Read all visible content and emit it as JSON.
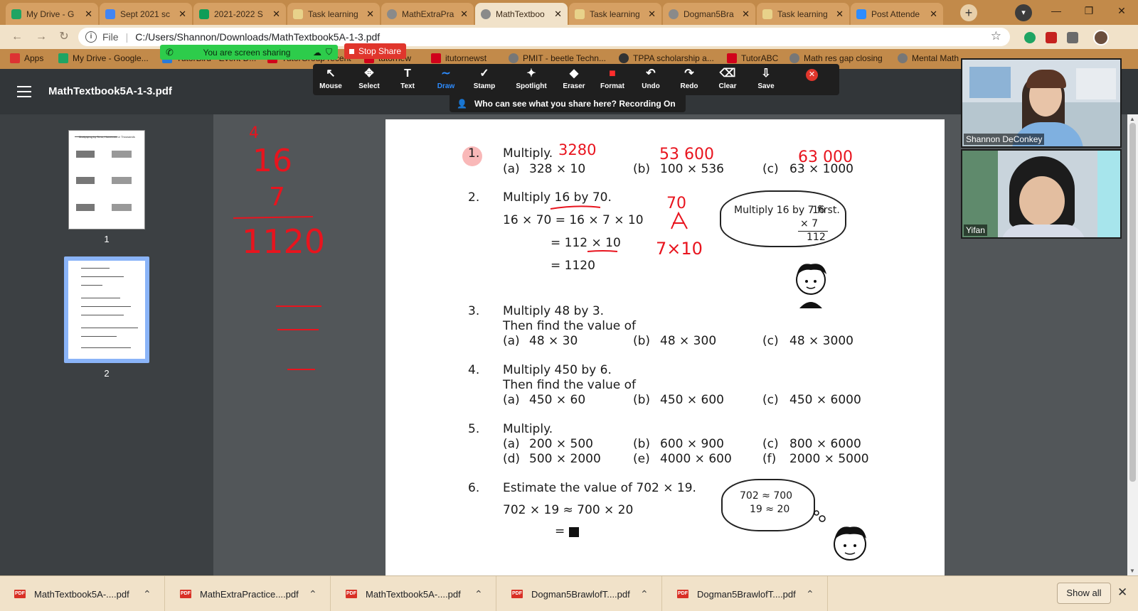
{
  "browser": {
    "tabs": [
      {
        "title": "My Drive - G",
        "favicon": "google-drive-icon",
        "color": "#1fa463"
      },
      {
        "title": "Sept 2021 sc",
        "favicon": "google-docs-icon",
        "color": "#4285f4"
      },
      {
        "title": "2021-2022 S",
        "favicon": "google-sheets-icon",
        "color": "#0f9d58"
      },
      {
        "title": "Task learning",
        "favicon": "task-icon",
        "color": "#e8d28a"
      },
      {
        "title": "MathExtraPra",
        "favicon": "globe-icon",
        "color": "#8a8a8a"
      },
      {
        "title": "MathTextboo",
        "favicon": "globe-icon",
        "color": "#8a8a8a"
      },
      {
        "title": "Task learning",
        "favicon": "task-icon",
        "color": "#e8d28a"
      },
      {
        "title": "Dogman5Bra",
        "favicon": "globe-icon",
        "color": "#8a8a8a"
      },
      {
        "title": "Task learning",
        "favicon": "task-icon",
        "color": "#e8d28a"
      },
      {
        "title": "Post Attende",
        "favicon": "zoom-icon",
        "color": "#2d8cff"
      }
    ],
    "active_tab": 5,
    "address": {
      "scheme": "File",
      "url": "C:/Users/Shannon/Downloads/MathTextbook5A-1-3.pdf"
    },
    "bookmarks": [
      {
        "label": "Apps",
        "icon": "apps-grid-icon",
        "color": "#d33"
      },
      {
        "label": "My Drive - Google...",
        "icon": "google-drive-icon",
        "color": "#1fa463"
      },
      {
        "label": "TutorBird - Event D...",
        "icon": "tutorbird-icon",
        "color": "#2a7bd8"
      },
      {
        "label": "TutorGroup recent",
        "icon": "info-icon",
        "color": "#d0021b"
      },
      {
        "label": "tutornew",
        "icon": "info-icon",
        "color": "#d0021b"
      },
      {
        "label": "itutornewst",
        "icon": "info-icon",
        "color": "#d0021b"
      },
      {
        "label": "PMIT - beetle Techn...",
        "icon": "globe-icon",
        "color": "#777"
      },
      {
        "label": "TPPA scholarship a...",
        "icon": "paw-icon",
        "color": "#333"
      },
      {
        "label": "TutorABC",
        "icon": "info-icon",
        "color": "#d0021b"
      },
      {
        "label": "Math res gap closing",
        "icon": "globe-icon",
        "color": "#777"
      },
      {
        "label": "Mental Math",
        "icon": "globe-icon",
        "color": "#777"
      }
    ]
  },
  "zoom": {
    "sharing_status": "You are screen sharing",
    "stop_share": "Stop Share",
    "tools": [
      {
        "label": "Mouse",
        "icon": "cursor-icon",
        "glyph": "↖"
      },
      {
        "label": "Select",
        "icon": "move-icon",
        "glyph": "✥"
      },
      {
        "label": "Text",
        "icon": "text-icon",
        "glyph": "T"
      },
      {
        "label": "Draw",
        "icon": "draw-icon",
        "glyph": "∼"
      },
      {
        "label": "Stamp",
        "icon": "stamp-icon",
        "glyph": "✓"
      },
      {
        "label": "Spotlight",
        "icon": "spotlight-icon",
        "glyph": "✦"
      },
      {
        "label": "Eraser",
        "icon": "eraser-icon",
        "glyph": "◆"
      },
      {
        "label": "Format",
        "icon": "format-icon",
        "glyph": "■"
      },
      {
        "label": "Undo",
        "icon": "undo-icon",
        "glyph": "↶"
      },
      {
        "label": "Redo",
        "icon": "redo-icon",
        "glyph": "↷"
      },
      {
        "label": "Clear",
        "icon": "trash-icon",
        "glyph": "🗑"
      },
      {
        "label": "Save",
        "icon": "save-icon",
        "glyph": "⇩"
      }
    ],
    "active_tool": "Draw",
    "recording_notice": "Who can see what you share here? Recording On",
    "participants": [
      {
        "name": "Shannon DeConkey"
      },
      {
        "name": "Yifan"
      }
    ]
  },
  "pdf": {
    "title": "MathTextbook5A-1-3.pdf",
    "pages": [
      "1",
      "2"
    ],
    "thumb1_heading": "Multiplying by Tens, Hundreds or Thousands",
    "content": {
      "q1": {
        "num": "1.",
        "prompt": "Multiply.",
        "a": "(a)",
        "a_expr": "328 × 10",
        "b": "(b)",
        "b_expr": "100 × 536",
        "c": "(c)",
        "c_expr": "63 × 1000"
      },
      "q2": {
        "num": "2.",
        "prompt": "Multiply 16 by 70.",
        "l1": "16 × 70  =  16 × 7 × 10",
        "l2": "=  112 × 10",
        "l3": "=  1120",
        "bubble_text": "Multiply 16 by 7 first.",
        "calc_top": "16",
        "calc_mid": "×  7",
        "calc_res": "112"
      },
      "q3": {
        "num": "3.",
        "prompt": "Multiply 48 by 3.",
        "prompt2": "Then find the value of",
        "a": "(a)",
        "a_expr": "48 × 30",
        "b": "(b)",
        "b_expr": "48 × 300",
        "c": "(c)",
        "c_expr": "48 × 3000"
      },
      "q4": {
        "num": "4.",
        "prompt": "Multiply 450 by 6.",
        "prompt2": "Then find the value of",
        "a": "(a)",
        "a_expr": "450 × 60",
        "b": "(b)",
        "b_expr": "450 × 600",
        "c": "(c)",
        "c_expr": "450 × 6000"
      },
      "q5": {
        "num": "5.",
        "prompt": "Multiply.",
        "a": "(a)",
        "a_expr": "200 × 500",
        "b": "(b)",
        "b_expr": "600 × 900",
        "c": "(c)",
        "c_expr": "800 × 6000",
        "d": "(d)",
        "d_expr": "500 × 2000",
        "e": "(e)",
        "e_expr": "4000 × 600",
        "f": "(f)",
        "f_expr": "2000 × 5000"
      },
      "q6": {
        "num": "6.",
        "prompt": "Estimate the value of 702 × 19.",
        "l1": "702 × 19 ≈ 700 × 20",
        "l2": "=",
        "bubble_l1": "702 ≈ 700",
        "bubble_l2": "19 ≈ 20"
      }
    },
    "annotations": {
      "sidebar_top": "4",
      "sidebar_16": "16",
      "sidebar_7": "7",
      "sidebar_1120": "1120",
      "q1a": "3280",
      "q1b": "53 600",
      "q1c": "63 000",
      "q2_70": "70",
      "q2_7x10": "7×10"
    },
    "ink_color": "#e8141e"
  },
  "downloads": {
    "items": [
      "MathTextbook5A-....pdf",
      "MathExtraPractice....pdf",
      "MathTextbook5A-....pdf",
      "Dogman5BrawlofT....pdf",
      "Dogman5BrawlofT....pdf"
    ],
    "show_all": "Show all"
  }
}
